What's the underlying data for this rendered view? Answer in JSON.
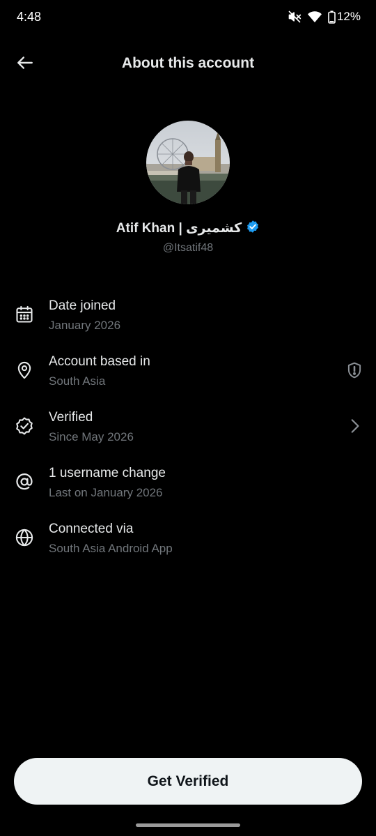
{
  "status_bar": {
    "time": "4:48",
    "battery_percent": "12%",
    "icons": [
      "mute-icon",
      "wifi-icon",
      "battery-icon"
    ]
  },
  "header": {
    "title": "About this account",
    "back_icon": "arrow-left-icon"
  },
  "profile": {
    "name": "Atif Khan | کشمیری",
    "handle": "@Itsatif48",
    "verified": true,
    "badge_color": "#1d9bf0"
  },
  "info_items": [
    {
      "icon": "calendar-icon",
      "title": "Date joined",
      "subtitle": "January 2026"
    },
    {
      "icon": "location-pin-icon",
      "title": "Account based in",
      "subtitle": "South Asia",
      "trailing_icon": "shield-alert-icon"
    },
    {
      "icon": "verified-check-icon",
      "title": "Verified",
      "subtitle": "Since May 2026",
      "trailing_icon": "chevron-right-icon"
    },
    {
      "icon": "at-sign-icon",
      "title": "1 username change",
      "subtitle": "Last on January 2026"
    },
    {
      "icon": "globe-icon",
      "title": "Connected via",
      "subtitle": "South Asia Android App"
    }
  ],
  "cta": {
    "label": "Get Verified"
  },
  "colors": {
    "background": "#000000",
    "primary_text": "#e7e9ea",
    "secondary_text": "#71767b",
    "button_bg": "#eff3f4",
    "button_text": "#0f1419"
  }
}
